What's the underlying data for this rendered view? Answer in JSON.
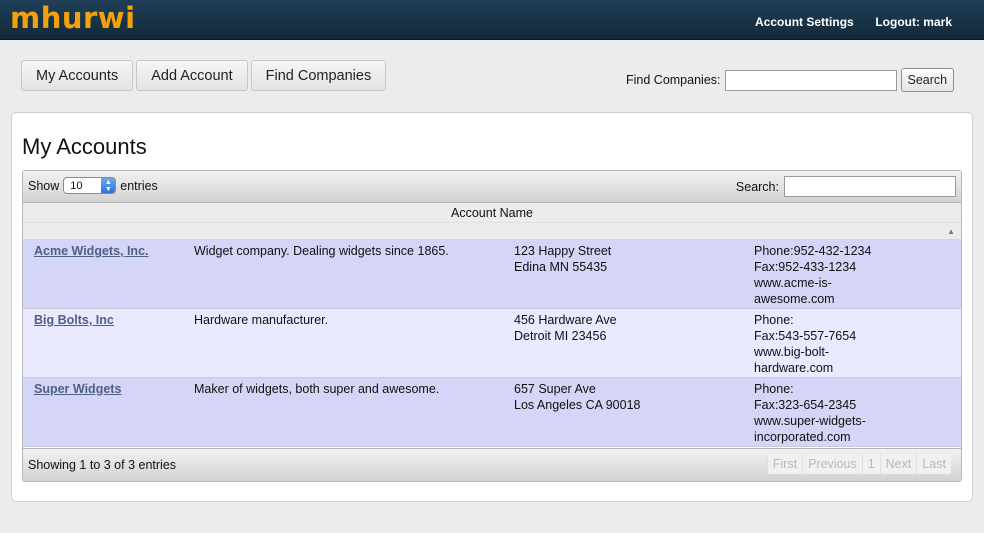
{
  "brand": {
    "logo": "mhurwi",
    "accent_color": "#f4a20b"
  },
  "topnav": {
    "settings": "Account Settings",
    "logout": "Logout: mark"
  },
  "tabs": [
    "My Accounts",
    "Add Account",
    "Find Companies"
  ],
  "find": {
    "label": "Find Companies:",
    "value": "",
    "button": "Search"
  },
  "main": {
    "title": "My Accounts",
    "show_label": "Show",
    "show_value": "10",
    "entries_label": "entries",
    "search_label": "Search:",
    "search_value": "",
    "column_header": "Account Name",
    "sort_icon": "sort-ascending-icon",
    "rows": [
      {
        "name": "Acme Widgets, Inc.",
        "desc": "Widget company. Dealing widgets since 1865.",
        "addr1": "123 Happy Street",
        "addr2": "Edina MN 55435",
        "phone": "Phone:952-432-1234",
        "fax": "Fax:952-433-1234",
        "web1": "www.acme-is-",
        "web2": "awesome.com"
      },
      {
        "name": "Big Bolts, Inc",
        "desc": "Hardware manufacturer.",
        "addr1": "456 Hardware Ave",
        "addr2": "Detroit MI 23456",
        "phone": "Phone:",
        "fax": "Fax:543-557-7654",
        "web1": "www.big-bolt-",
        "web2": "hardware.com"
      },
      {
        "name": "Super Widgets",
        "desc": "Maker of widgets, both super and awesome.",
        "addr1": "657 Super Ave",
        "addr2": "Los Angeles CA 90018",
        "phone": "Phone:",
        "fax": "Fax:323-654-2345",
        "web1": "www.super-widgets-",
        "web2": "incorporated.com"
      }
    ],
    "info": "Showing 1 to 3 of 3 entries",
    "pager": {
      "first": "First",
      "previous": "Previous",
      "page": "1",
      "next": "Next",
      "last": "Last"
    }
  }
}
